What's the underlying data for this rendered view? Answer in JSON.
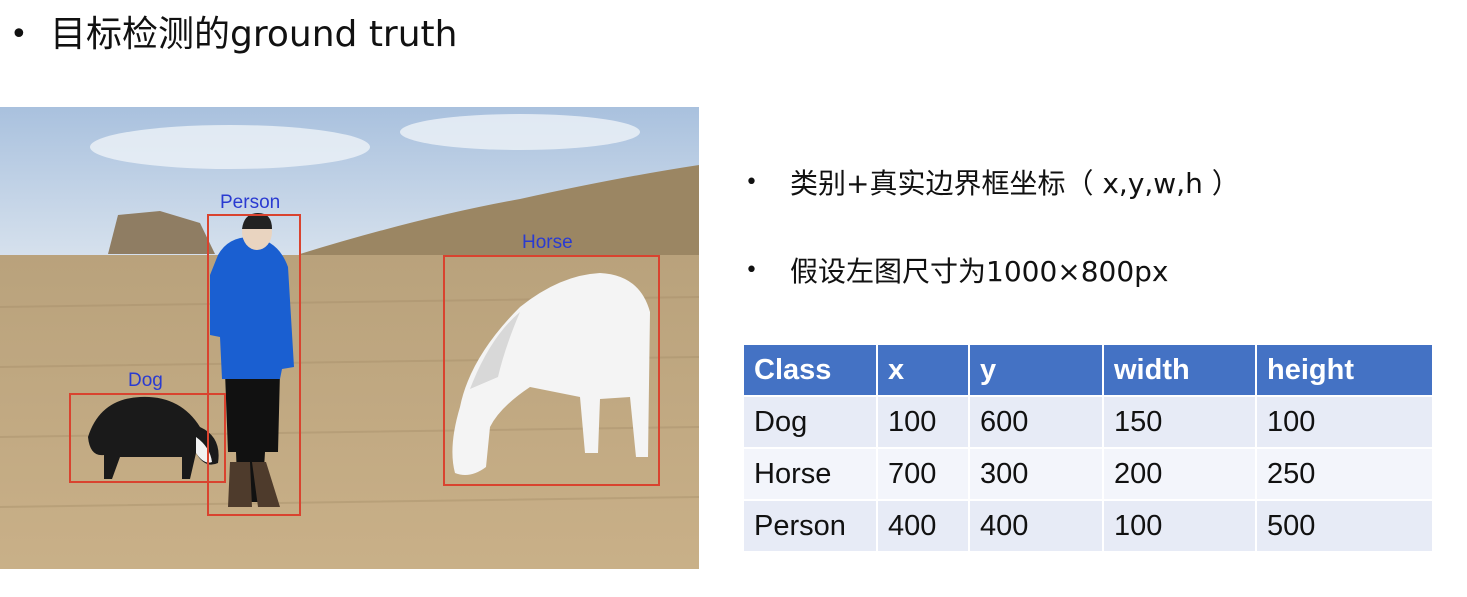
{
  "slide": {
    "title": "目标检测的ground truth",
    "bullet_symbol": "•",
    "points": [
      "类别+真实边界框坐标（ x,y,w,h ）",
      "假设左图尺寸为1000×800px"
    ]
  },
  "image": {
    "labels": {
      "person": "Person",
      "horse": "Horse",
      "dog": "Dog"
    },
    "box_color": "#d9432f",
    "label_color": "#2a3bd1"
  },
  "table": {
    "headers": [
      "Class",
      "x",
      "y",
      "width",
      "height"
    ],
    "rows": [
      [
        "Dog",
        "100",
        "600",
        "150",
        "100"
      ],
      [
        "Horse",
        "700",
        "300",
        "200",
        "250"
      ],
      [
        "Person",
        "400",
        "400",
        "100",
        "500"
      ]
    ],
    "header_color": "#4472c4"
  }
}
